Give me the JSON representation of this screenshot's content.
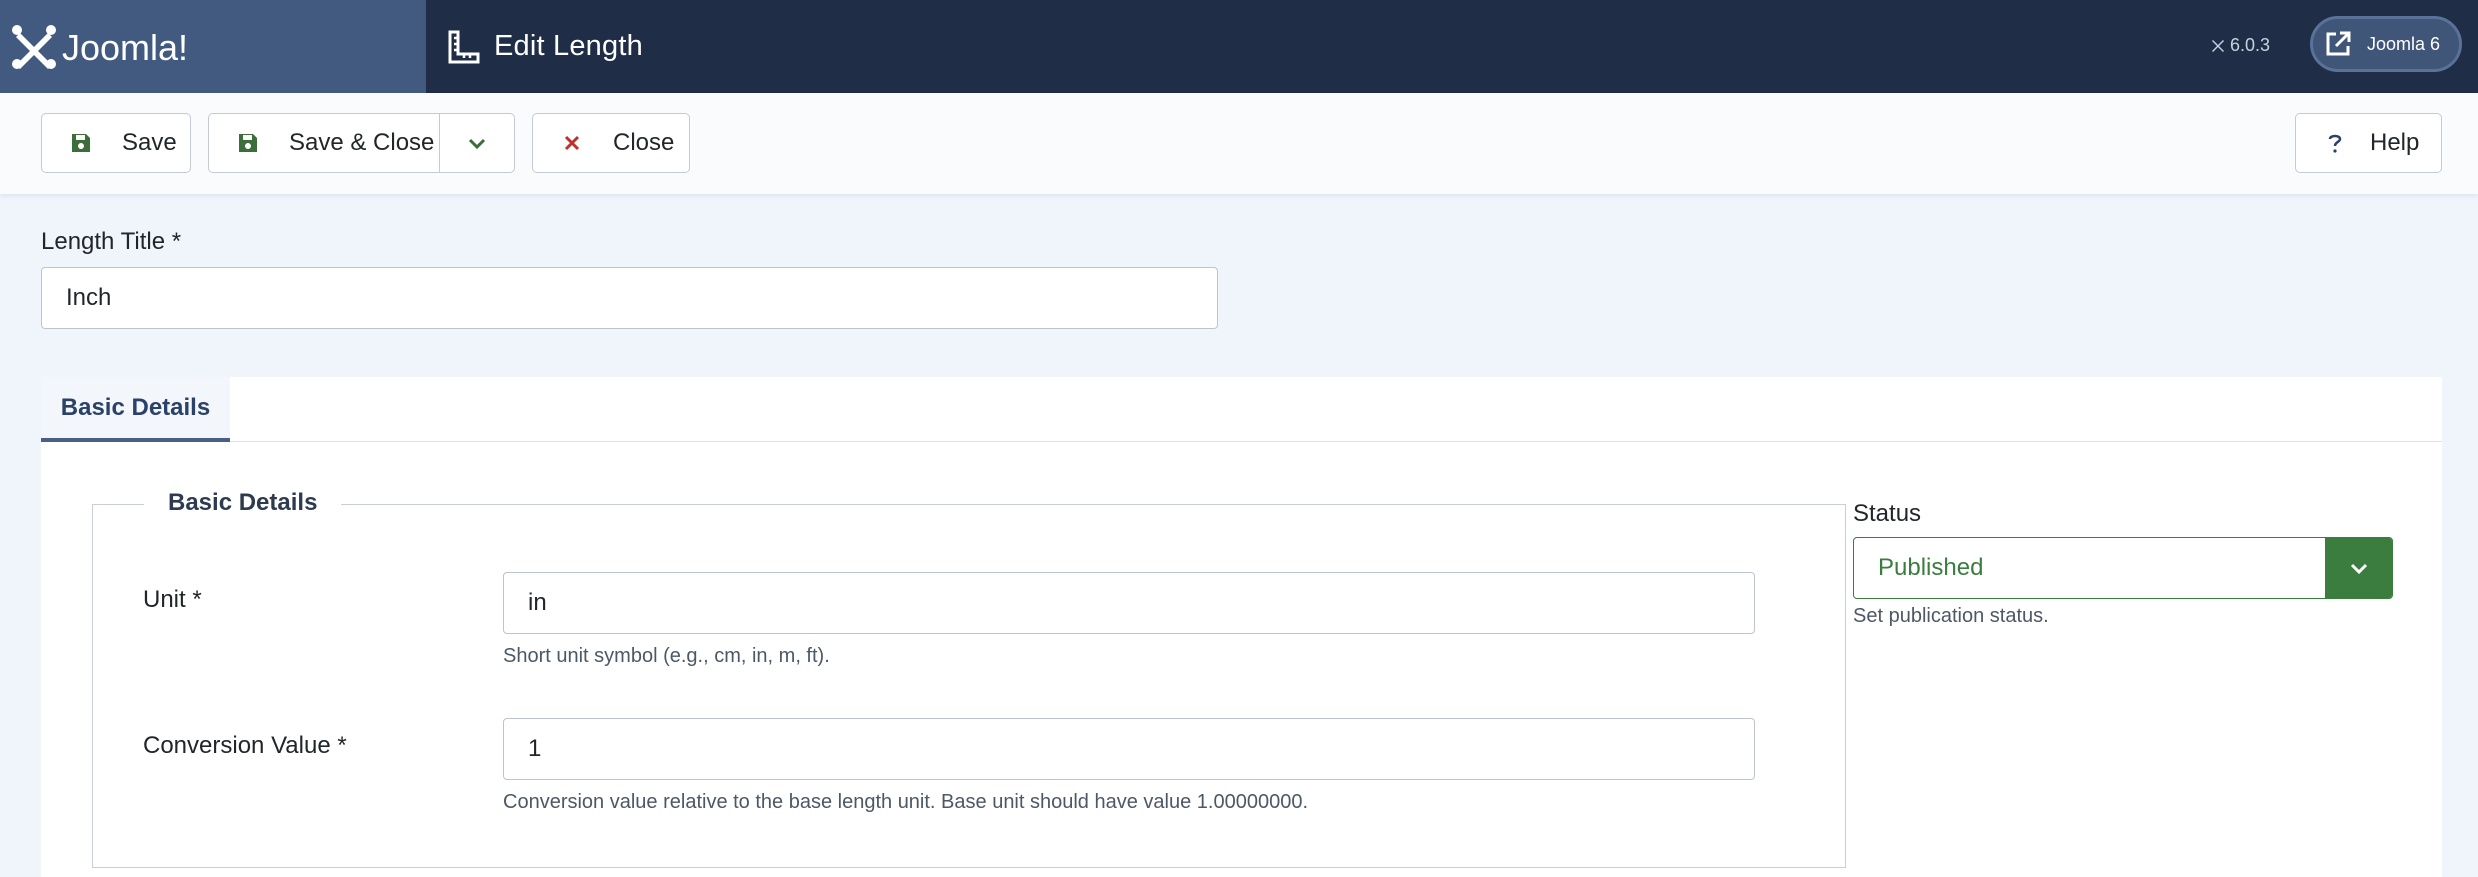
{
  "header": {
    "logo_text": "Joomla!",
    "page_title": "Edit Length",
    "version": "6.0.3",
    "site_link_label": "Joomla 6"
  },
  "toolbar": {
    "save_label": "Save",
    "save_close_label": "Save & Close",
    "close_label": "Close",
    "help_label": "Help"
  },
  "form": {
    "title_label": "Length Title *",
    "title_value": "Inch"
  },
  "tabs": [
    {
      "label": "Basic Details",
      "active": true
    }
  ],
  "basic_details": {
    "legend": "Basic Details",
    "unit_label": "Unit *",
    "unit_value": "in",
    "unit_hint": "Short unit symbol (e.g., cm, in, m, ft).",
    "conversion_label": "Conversion Value *",
    "conversion_value": "1",
    "conversion_hint": "Conversion value relative to the base length unit. Base unit should have value 1.00000000."
  },
  "status": {
    "label": "Status",
    "selected": "Published",
    "hint": "Set publication status."
  },
  "colors": {
    "header_bg": "#1f2d47",
    "logo_bg": "#435a80",
    "status_green": "#3b7d3e",
    "close_red": "#c0302a",
    "save_green": "#3b6e3a"
  },
  "icons": {
    "logo": "joomla-logo-icon",
    "title": "ruler-icon",
    "save": "floppy-disk-icon",
    "dropdown": "chevron-down-icon",
    "close": "x-icon",
    "help": "question-icon",
    "external": "external-link-icon"
  }
}
